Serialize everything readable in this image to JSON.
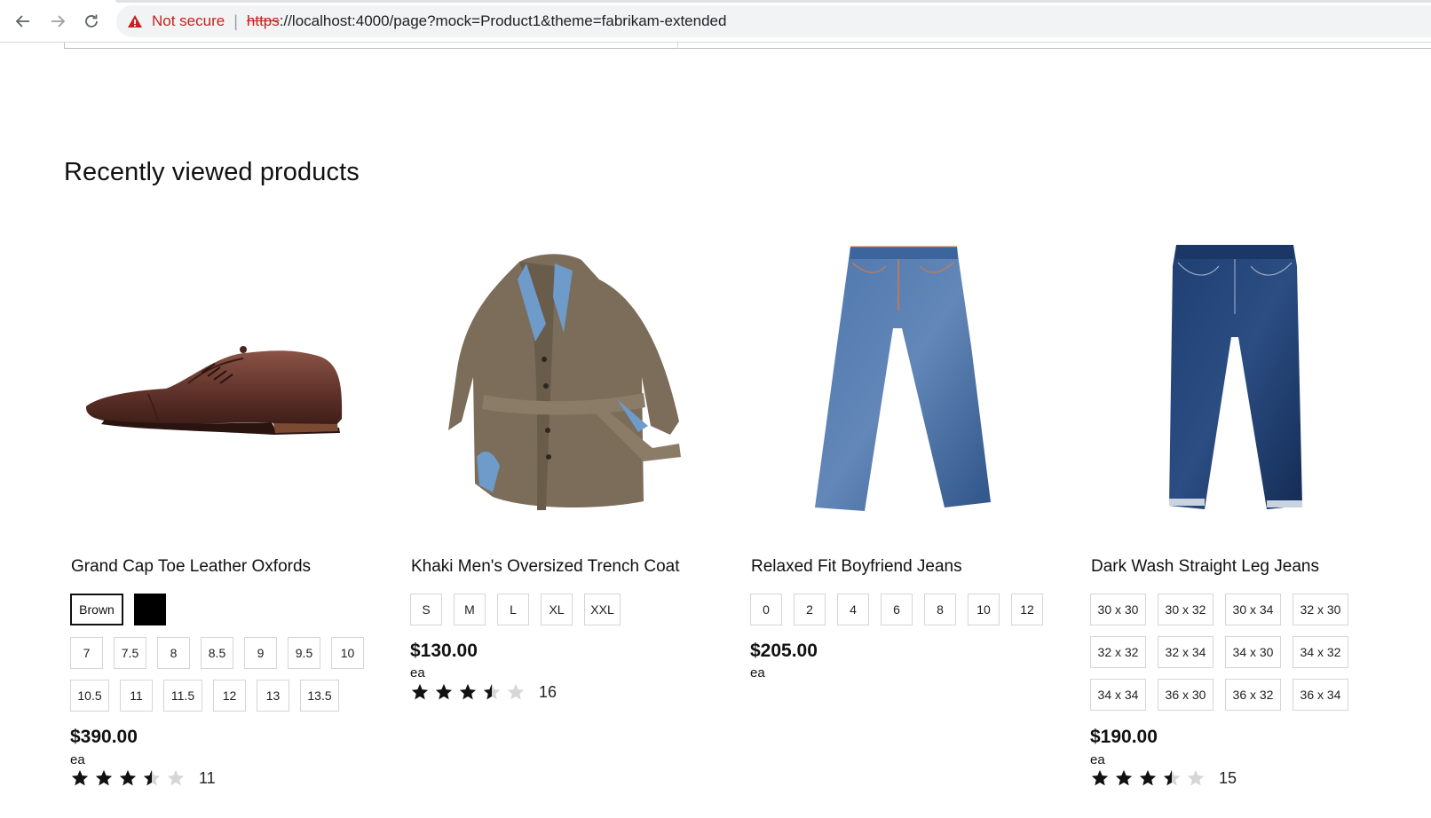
{
  "browser": {
    "back_icon": "arrow-left-icon",
    "forward_icon": "arrow-right-icon",
    "reload_icon": "reload-icon",
    "security_label": "Not secure",
    "url_scheme": "https",
    "url_rest": "://localhost:4000/page?mock=Product1&theme=fabrikam-extended",
    "warning_color": "#c5221f"
  },
  "section": {
    "title": "Recently viewed products"
  },
  "products": [
    {
      "name": "Grand Cap Toe Leather Oxfords",
      "image_icon": "oxford-shoe-image",
      "colors": [
        {
          "label": "Brown",
          "selected": true
        },
        {
          "label": "",
          "swatch": "#000000"
        }
      ],
      "sizes": [
        "7",
        "7.5",
        "8",
        "8.5",
        "9",
        "9.5",
        "10",
        "10.5",
        "11",
        "11.5",
        "12",
        "13",
        "13.5"
      ],
      "price": "$390.00",
      "unit": "ea",
      "rating": 3.5,
      "rating_count": "11"
    },
    {
      "name": "Khaki Men's Oversized Trench Coat",
      "image_icon": "trench-coat-image",
      "sizes": [
        "S",
        "M",
        "L",
        "XL",
        "XXL"
      ],
      "price": "$130.00",
      "unit": "ea",
      "rating": 3.5,
      "rating_count": "16"
    },
    {
      "name": "Relaxed Fit Boyfriend Jeans",
      "image_icon": "light-jeans-image",
      "sizes": [
        "0",
        "2",
        "4",
        "6",
        "8",
        "10",
        "12"
      ],
      "price": "$205.00",
      "unit": "ea"
    },
    {
      "name": "Dark Wash Straight Leg Jeans",
      "image_icon": "dark-jeans-image",
      "sizes": [
        "30 x 30",
        "30 x 32",
        "30 x 34",
        "32 x 30",
        "32 x 32",
        "32 x 34",
        "34 x 30",
        "34 x 32",
        "34 x 34",
        "36 x 30",
        "36 x 32",
        "36 x 34"
      ],
      "price": "$190.00",
      "unit": "ea",
      "rating": 3.5,
      "rating_count": "15"
    }
  ],
  "colors": {
    "star_filled": "#111111",
    "star_empty": "#d6d6d6"
  }
}
